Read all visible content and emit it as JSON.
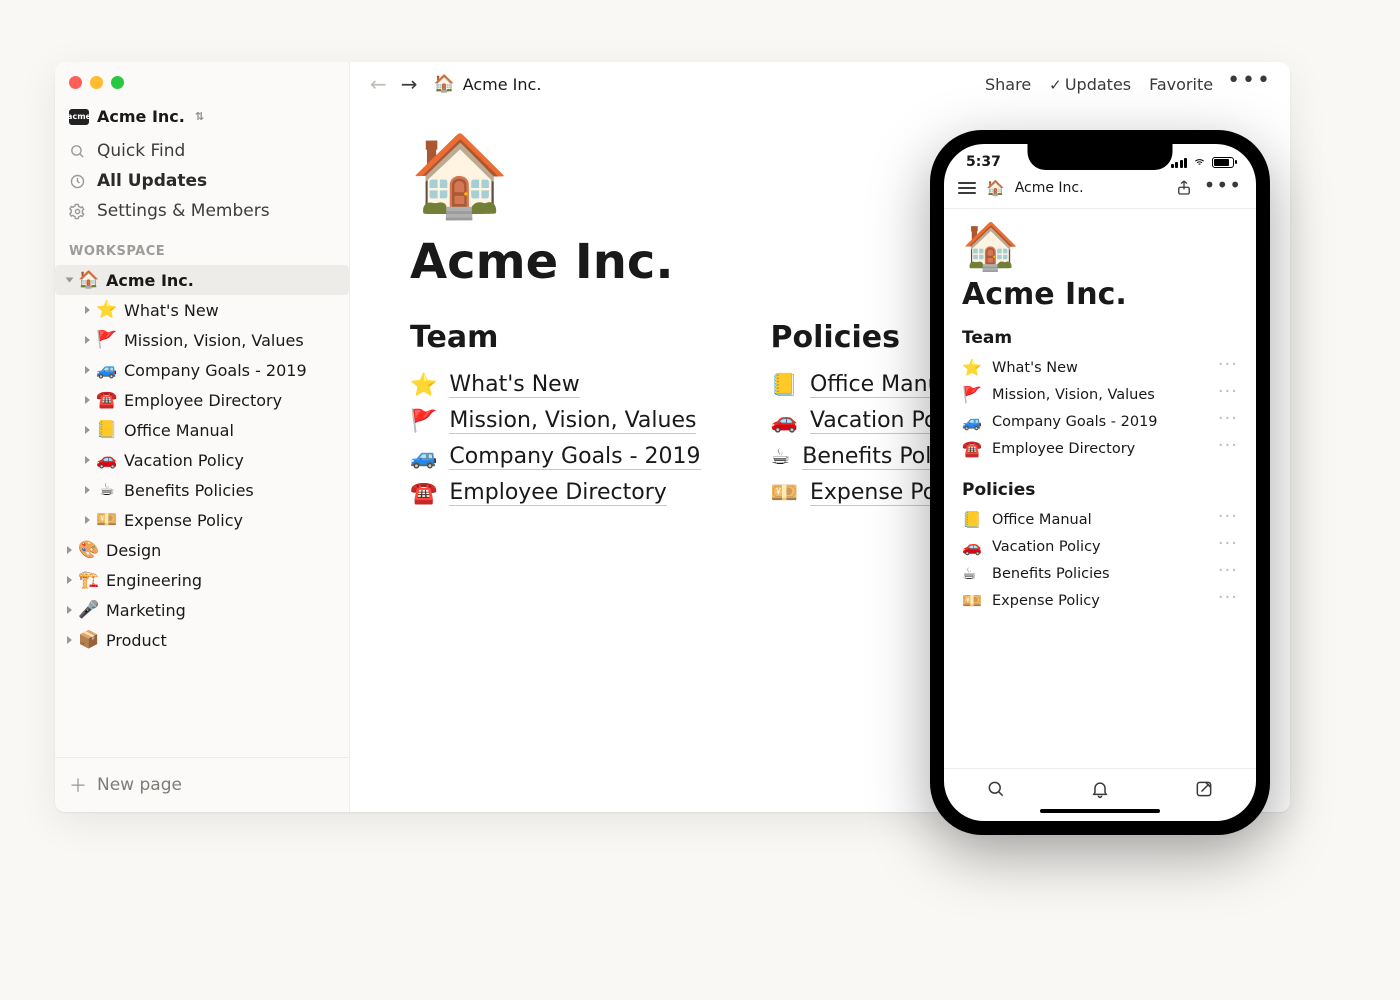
{
  "workspace": {
    "name": "Acme Inc.",
    "badge": "acme"
  },
  "sidebar": {
    "quick_find": "Quick Find",
    "all_updates": "All Updates",
    "settings": "Settings & Members",
    "section_label": "WORKSPACE",
    "new_page": "New page",
    "root": {
      "icon": "🏠",
      "label": "Acme Inc.",
      "children": [
        {
          "icon": "⭐",
          "label": "What's New"
        },
        {
          "icon": "🚩",
          "label": "Mission, Vision, Values"
        },
        {
          "icon": "🚙",
          "label": "Company Goals - 2019"
        },
        {
          "icon": "☎️",
          "label": "Employee Directory"
        },
        {
          "icon": "📒",
          "label": "Office Manual"
        },
        {
          "icon": "🚗",
          "label": "Vacation Policy"
        },
        {
          "icon": "☕",
          "label": "Benefits Policies"
        },
        {
          "icon": "💴",
          "label": "Expense Policy"
        }
      ]
    },
    "others": [
      {
        "icon": "🎨",
        "label": "Design"
      },
      {
        "icon": "🏗️",
        "label": "Engineering"
      },
      {
        "icon": "🎤",
        "label": "Marketing"
      },
      {
        "icon": "📦",
        "label": "Product"
      }
    ]
  },
  "topbar": {
    "breadcrumb_icon": "🏠",
    "breadcrumb": "Acme Inc.",
    "share": "Share",
    "updates": "Updates",
    "favorite": "Favorite"
  },
  "page": {
    "icon": "🏠",
    "title": "Acme Inc.",
    "columns": [
      {
        "heading": "Team",
        "items": [
          {
            "icon": "⭐",
            "label": "What's New"
          },
          {
            "icon": "🚩",
            "label": "Mission, Vision, Values"
          },
          {
            "icon": "🚙",
            "label": "Company Goals - 2019"
          },
          {
            "icon": "☎️",
            "label": "Employee Directory"
          }
        ]
      },
      {
        "heading": "Policies",
        "items": [
          {
            "icon": "📒",
            "label": "Office Manual"
          },
          {
            "icon": "🚗",
            "label": "Vacation Policy"
          },
          {
            "icon": "☕",
            "label": "Benefits Policies"
          },
          {
            "icon": "💴",
            "label": "Expense Policy"
          }
        ]
      }
    ]
  },
  "phone": {
    "time": "5:37",
    "breadcrumb_icon": "🏠",
    "breadcrumb": "Acme Inc.",
    "page_icon": "🏠",
    "page_title": "Acme Inc.",
    "sections": [
      {
        "heading": "Team",
        "items": [
          {
            "icon": "⭐",
            "label": "What's New"
          },
          {
            "icon": "🚩",
            "label": "Mission, Vision, Values"
          },
          {
            "icon": "🚙",
            "label": "Company Goals - 2019"
          },
          {
            "icon": "☎️",
            "label": "Employee Directory"
          }
        ]
      },
      {
        "heading": "Policies",
        "items": [
          {
            "icon": "📒",
            "label": "Office Manual"
          },
          {
            "icon": "🚗",
            "label": "Vacation Policy"
          },
          {
            "icon": "☕",
            "label": "Benefits Policies"
          },
          {
            "icon": "💴",
            "label": "Expense Policy"
          }
        ]
      }
    ]
  }
}
